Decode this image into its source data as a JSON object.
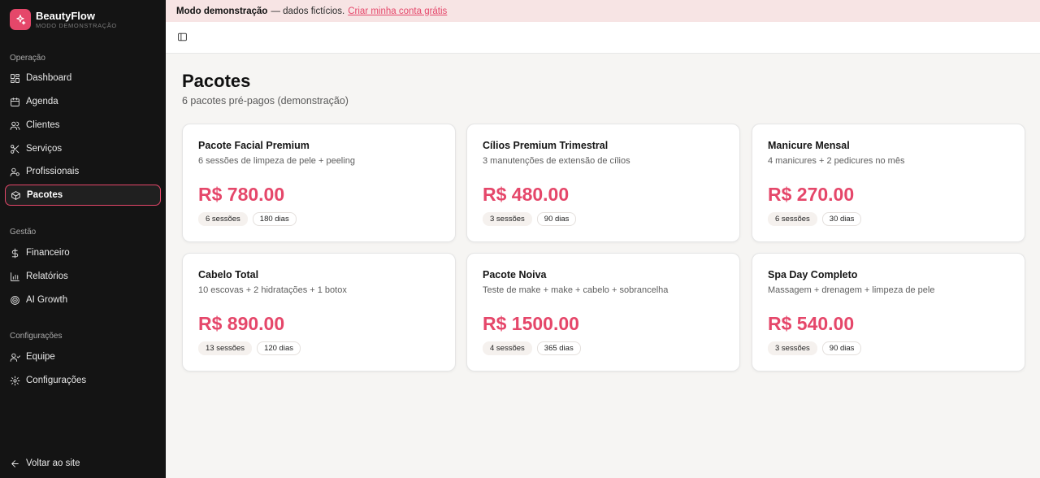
{
  "brand": {
    "name": "BeautyFlow",
    "subtitle": "MODO DEMONSTRAÇÃO",
    "accent": "#e5476a"
  },
  "sidebar": {
    "sections": [
      {
        "label": "Operação"
      },
      {
        "label": "Gestão"
      },
      {
        "label": "Configurações"
      }
    ],
    "items": [
      {
        "label": "Dashboard",
        "icon": "dashboard-icon"
      },
      {
        "label": "Agenda",
        "icon": "calendar-icon"
      },
      {
        "label": "Clientes",
        "icon": "users-icon"
      },
      {
        "label": "Serviços",
        "icon": "scissors-icon"
      },
      {
        "label": "Profissionais",
        "icon": "user-cog-icon"
      },
      {
        "label": "Pacotes",
        "icon": "package-icon",
        "active": true
      },
      {
        "label": "Financeiro",
        "icon": "dollar-icon"
      },
      {
        "label": "Relatórios",
        "icon": "bar-chart-icon"
      },
      {
        "label": "AI Growth",
        "icon": "target-icon"
      },
      {
        "label": "Equipe",
        "icon": "team-icon"
      },
      {
        "label": "Configurações",
        "icon": "gear-icon"
      }
    ],
    "back_label": "Voltar ao site"
  },
  "banner": {
    "bold": "Modo demonstração",
    "text": "— dados fictícios.",
    "link": "Criar minha conta grátis"
  },
  "page": {
    "title": "Pacotes",
    "subtitle": "6 pacotes pré-pagos (demonstração)"
  },
  "packages": [
    {
      "name": "Pacote Facial Premium",
      "description": "6 sessões de limpeza de pele + peeling",
      "price": "R$ 780.00",
      "sessions": "6 sessões",
      "days": "180 dias"
    },
    {
      "name": "Cílios Premium Trimestral",
      "description": "3 manutenções de extensão de cílios",
      "price": "R$ 480.00",
      "sessions": "3 sessões",
      "days": "90 dias"
    },
    {
      "name": "Manicure Mensal",
      "description": "4 manicures + 2 pedicures no mês",
      "price": "R$ 270.00",
      "sessions": "6 sessões",
      "days": "30 dias"
    },
    {
      "name": "Cabelo Total",
      "description": "10 escovas + 2 hidratações + 1 botox",
      "price": "R$ 890.00",
      "sessions": "13 sessões",
      "days": "120 dias"
    },
    {
      "name": "Pacote Noiva",
      "description": "Teste de make + make + cabelo + sobrancelha",
      "price": "R$ 1500.00",
      "sessions": "4 sessões",
      "days": "365 dias"
    },
    {
      "name": "Spa Day Completo",
      "description": "Massagem + drenagem + limpeza de pele",
      "price": "R$ 540.00",
      "sessions": "3 sessões",
      "days": "90 dias"
    }
  ]
}
